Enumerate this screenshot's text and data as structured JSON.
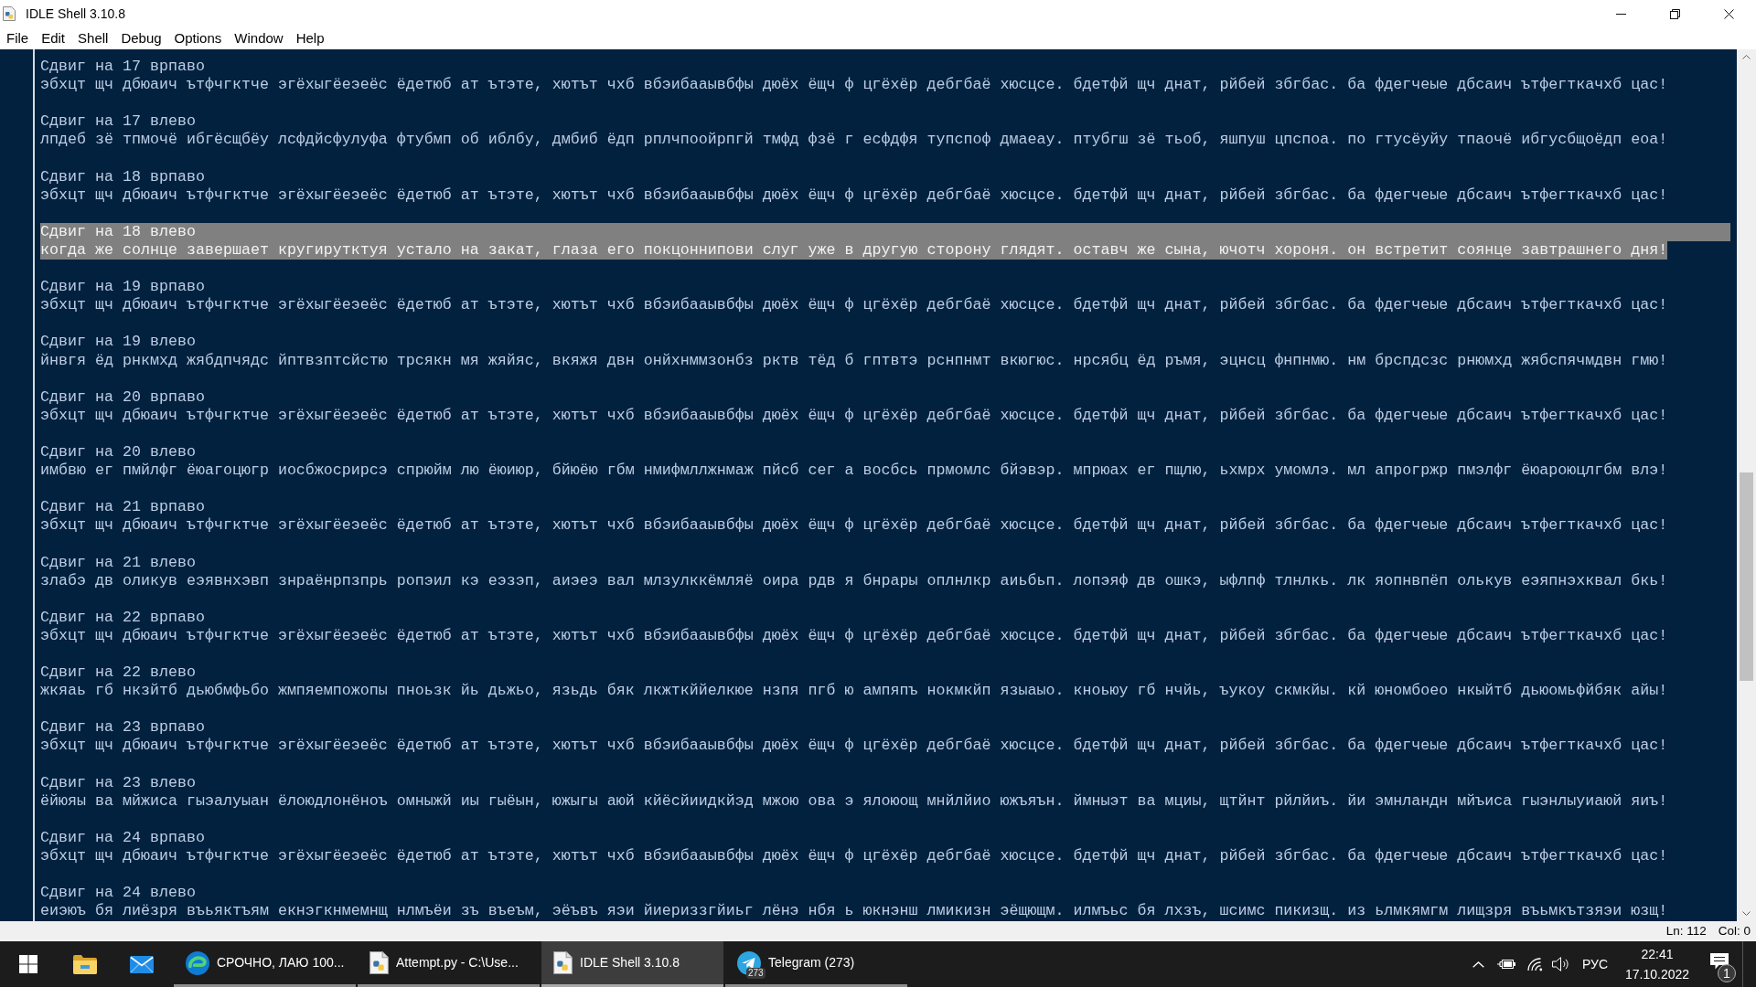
{
  "window": {
    "title": "IDLE Shell 3.10.8"
  },
  "menu_bar": [
    "File",
    "Edit",
    "Shell",
    "Debug",
    "Options",
    "Window",
    "Help"
  ],
  "shell_output": [
    {
      "heading": "Сдвиг на 17 врпаво",
      "line": "эбхцт щч дбюаич ътфчгктче эгёхыгёеэеёс ёдетюб ат ътэте, хютът чхб вбэибааывбфы дюёх ёщч ф цгёхёр дебгбаё хюсцсе. бдетфй щч днат, рйбей збгбас. ба фдегчеые дбсаич ътфегткачхб цас!",
      "selected": false
    },
    {
      "heading": "Сдвиг на 17 влево",
      "line": "лпдеб зё тпмочё ибгёсщбёу лсфдйсфулуфа фтубмп об иблбу, дмбиб ёдп рплчпоойрпгй тмфд фзё г есфдфя тупспоф дмаеау. птубгш зё тьоб, яшпуш цпспоа. по гтусёуйу тпаочё ибгусбщоёдп еоа!",
      "selected": false
    },
    {
      "heading": "Сдвиг на 18 врпаво",
      "line": "эбхцт щч дбюаич ътфчгктче эгёхыгёеэеёс ёдетюб ат ътэте, хютът чхб вбэибааывбфы дюёх ёщч ф цгёхёр дебгбаё хюсцсе. бдетфй щч днат, рйбей збгбас. ба фдегчеые дбсаич ътфегткачхб цас!",
      "selected": false
    },
    {
      "heading": "Сдвиг на 18 влево",
      "line": "когда же солнце завершает кругирутктуя устало на закат, глаза его покцоннипови слуг уже в другую сторону глядят. оставч же сына, ючотч хороня. он встретит соянце завтрашнего дня!",
      "selected": true
    },
    {
      "heading": "Сдвиг на 19 врпаво",
      "line": "эбхцт щч дбюаич ътфчгктче эгёхыгёеэеёс ёдетюб ат ътэте, хютът чхб вбэибааывбфы дюёх ёщч ф цгёхёр дебгбаё хюсцсе. бдетфй щч днат, рйбей збгбас. ба фдегчеые дбсаич ътфегткачхб цас!",
      "selected": false
    },
    {
      "heading": "Сдвиг на 19 влево",
      "line": "йнвгя ёд рнкмхд жябдпчядс йптвзптсйстю трсякн мя жяйяс, вкяжя двн онйхнммзонбз рктв тёд б гптвтэ рснпнмт вкюгюс. нрсябц ёд ръмя, эцнсц фнпнмю. нм брспдсзс рнюмхд жябспячмдвн гмю!",
      "selected": false
    },
    {
      "heading": "Сдвиг на 20 врпаво",
      "line": "эбхцт щч дбюаич ътфчгктче эгёхыгёеэеёс ёдетюб ат ътэте, хютът чхб вбэибааывбфы дюёх ёщч ф цгёхёр дебгбаё хюсцсе. бдетфй щч днат, рйбей збгбас. ба фдегчеые дбсаич ътфегткачхб цас!",
      "selected": false
    },
    {
      "heading": "Сдвиг на 20 влево",
      "line": "имбвю ег пмйлфг ёюагоцюгр иосбжосрирсэ спрюйм лю ёюиюр, бйюёю гбм нмифмллжнмаж пйсб сег а восбсь прмомлс бйэвэр. мпрюах ег пщлю, ьхмрх умомлэ. мл апрогржр пмэлфг ёюароюцлгбм влэ!",
      "selected": false
    },
    {
      "heading": "Сдвиг на 21 врпаво",
      "line": "эбхцт щч дбюаич ътфчгктче эгёхыгёеэеёс ёдетюб ат ътэте, хютът чхб вбэибааывбфы дюёх ёщч ф цгёхёр дебгбаё хюсцсе. бдетфй щч днат, рйбей збгбас. ба фдегчеые дбсаич ътфегткачхб цас!",
      "selected": false
    },
    {
      "heading": "Сдвиг на 21 влево",
      "line": "злабэ дв оликув еэявнхэвп знраёнрпзпрь ропэил кэ еэзэп, аиэеэ вал млзулккёмляё оира рдв я бнрары оплнлкр аиьбьп. лопэяф дв ошкэ, ыфлпф тлнлкь. лк яопнвпёп олькув еэяпнэхквал бкь!",
      "selected": false
    },
    {
      "heading": "Сдвиг на 22 врпаво",
      "line": "эбхцт щч дбюаич ътфчгктче эгёхыгёеэеёс ёдетюб ат ътэте, хютът чхб вбэибааывбфы дюёх ёщч ф цгёхёр дебгбаё хюсцсе. бдетфй щч днат, рйбей збгбас. ба фдегчеые дбсаич ътфегткачхб цас!",
      "selected": false
    },
    {
      "heading": "Сдвиг на 22 влево",
      "line": "жкяаь гб нкзйтб дьюбмфьбо жмпяемпожопы пноьзк йь дьжьо, язьдь бяк лкжткййелкюе нзпя пгб ю ампяпъ нокмкйп языаыо. кноьюу гб нчйь, ъукоу скмкйы. кй юномбоео нкыйтб дьюомьфйбяк айы!",
      "selected": false
    },
    {
      "heading": "Сдвиг на 23 врпаво",
      "line": "эбхцт щч дбюаич ътфчгктче эгёхыгёеэеёс ёдетюб ат ътэте, хютът чхб вбэибааывбфы дюёх ёщч ф цгёхёр дебгбаё хюсцсе. бдетфй щч днат, рйбей збгбас. ба фдегчеые дбсаич ътфегткачхб цас!",
      "selected": false
    },
    {
      "heading": "Сдвиг на 23 влево",
      "line": "ёйюяы ва мйжиса гыэалуыан ёлоюдлонёноъ омныжй иы гыёын, южыгы аюй кйёсйиидкйэд мжою ова э ялоюощ мнйлйио южъяън. ймныэт ва мциы, щтйнт рйлйиъ. йи эмнландн мйъиса гыэнлыуиаюй яиъ!",
      "selected": false
    },
    {
      "heading": "Сдвиг на 24 врпаво",
      "line": "эбхцт щч дбюаич ътфчгктче эгёхыгёеэеёс ёдетюб ат ътэте, хютът чхб вбэибааывбфы дюёх ёщч ф цгёхёр дебгбаё хюсцсе. бдетфй щч днат, рйбей збгбас. ба фдегчеые дбсаич ътфегткачхб цас!",
      "selected": false
    },
    {
      "heading": "Сдвиг на 24 влево",
      "line": "еиэюъ бя лиёзря въьяктъям екнэгкнмемнщ нлмъёи зъ въеъм, эёъвъ яэи йиериззгйиьг лёнэ нбя ь юкнэнш лмикизн эёщющм. илмъьс бя лхзъ, шсимс пикизщ. из ьлмкямгм лищзря въьмкътзяэи юзщ!",
      "selected": false
    }
  ],
  "status_bar": {
    "line": "Ln: 112",
    "column": "Col: 0"
  },
  "taskbar": {
    "windows": [
      {
        "label": "СРОЧНО, ЛАЮ 100...",
        "selected": false
      },
      {
        "label": "Attempt.py - C:\\Use...",
        "selected": false
      },
      {
        "label": "IDLE Shell 3.10.8",
        "selected": true
      },
      {
        "label": "Telegram (273)",
        "selected": false,
        "badge": "273"
      }
    ],
    "tray": {
      "language": "РУС",
      "time": "22:41",
      "date": "17.10.2022",
      "notification_count": "1"
    }
  }
}
